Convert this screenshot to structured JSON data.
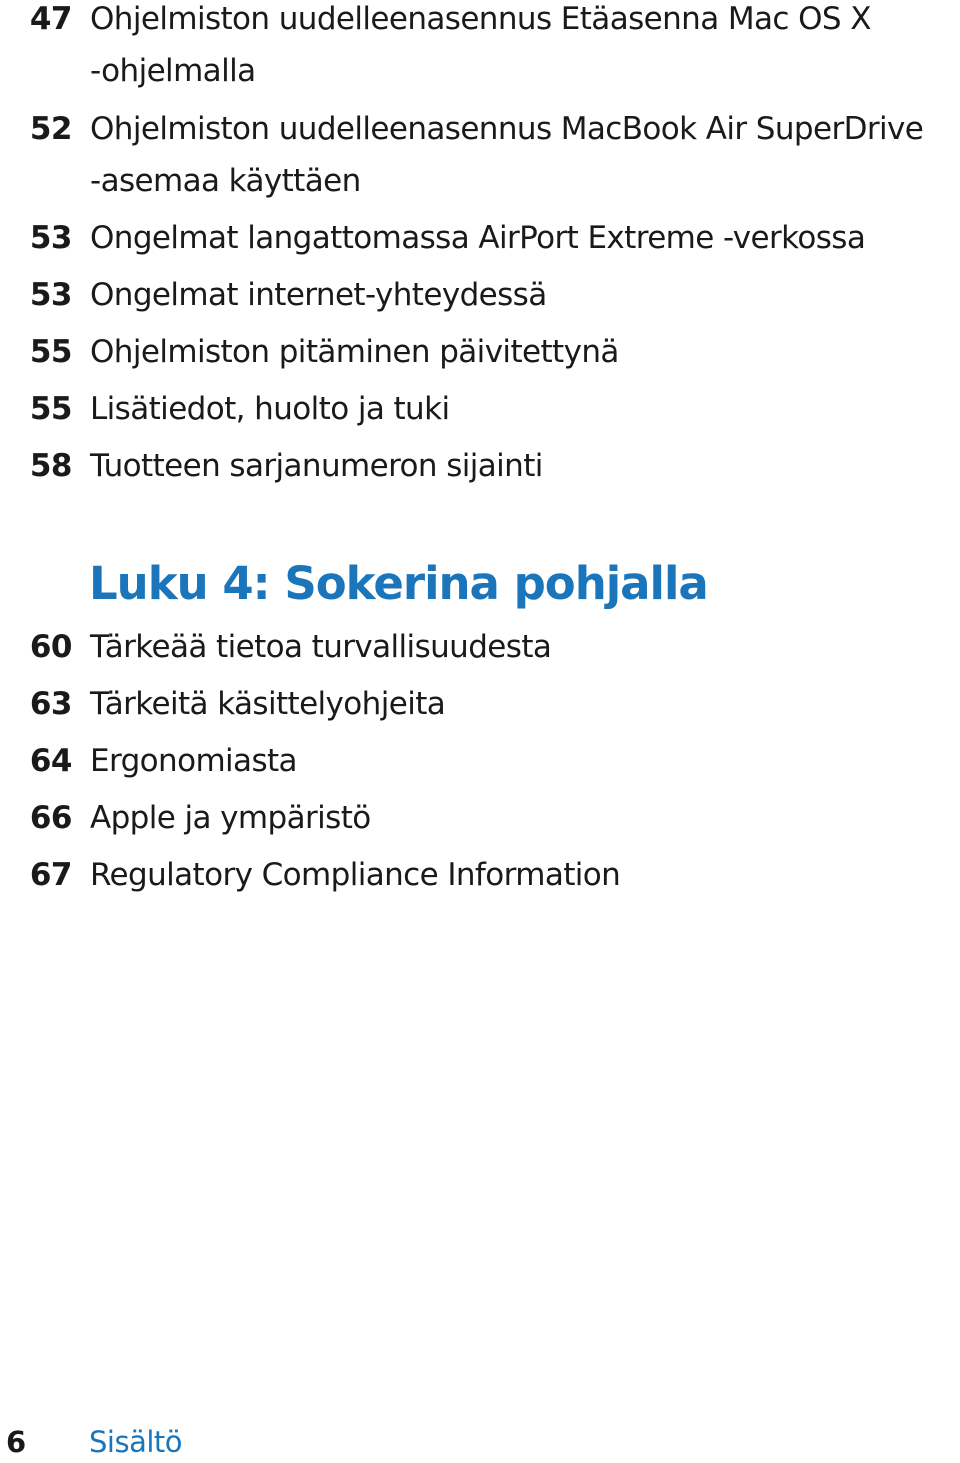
{
  "entries_top": [
    {
      "page": "47",
      "title": "Ohjelmiston uudelleenasennus Etäasenna Mac OS X",
      "title_cont": "-ohjelmalla"
    },
    {
      "page": "52",
      "title": "Ohjelmiston uudelleenasennus MacBook Air SuperDrive",
      "title_cont": "-asemaa käyttäen"
    },
    {
      "page": "53",
      "title": "Ongelmat langattomassa AirPort Extreme -verkossa"
    },
    {
      "page": "53",
      "title": "Ongelmat internet-yhteydessä"
    },
    {
      "page": "55",
      "title": "Ohjelmiston pitäminen päivitettynä"
    },
    {
      "page": "55",
      "title": "Lisätiedot, huolto ja tuki"
    },
    {
      "page": "58",
      "title": "Tuotteen sarjanumeron sijainti"
    }
  ],
  "chapter": {
    "label": "Luku 4:",
    "title": "Sokerina pohjalla",
    "full": "Luku 4: Sokerina pohjalla"
  },
  "entries_chapter4": [
    {
      "page": "60",
      "title": "Tärkeää tietoa turvallisuudesta"
    },
    {
      "page": "63",
      "title": "Tärkeitä käsittelyohjeita"
    },
    {
      "page": "64",
      "title": "Ergonomiasta"
    },
    {
      "page": "66",
      "title": "Apple ja ympäristö"
    },
    {
      "page": "67",
      "title": "Regulatory Compliance Information"
    }
  ],
  "footer": {
    "page_number": "6",
    "section": "Sisältö"
  },
  "colors": {
    "accent": "#1b75bb",
    "text": "#1a1a1a"
  }
}
